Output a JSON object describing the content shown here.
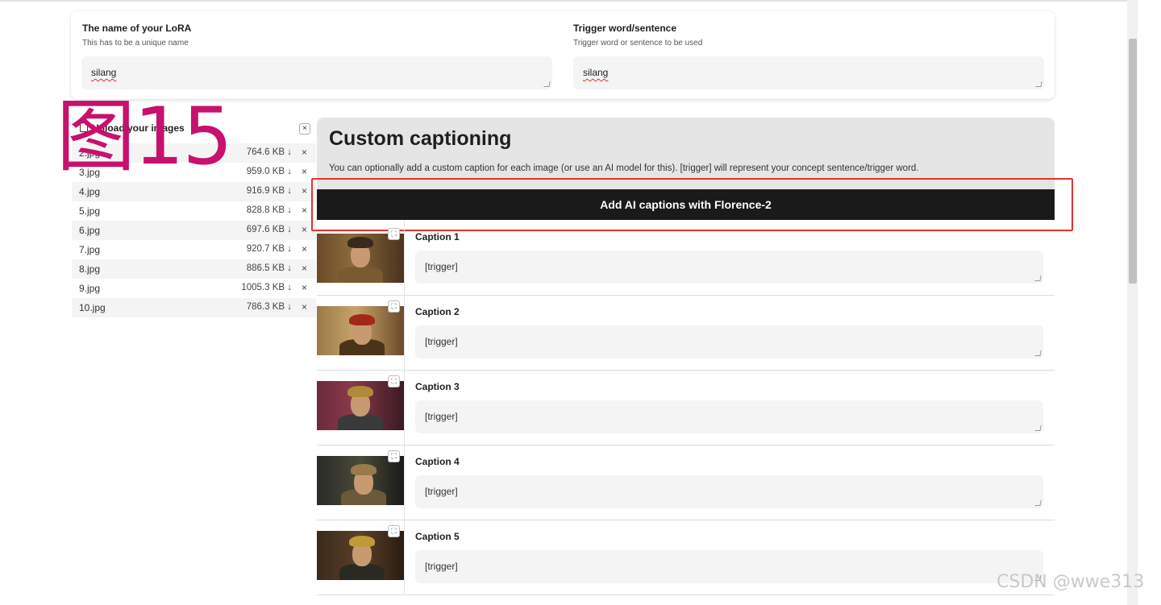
{
  "figure_label": "图15",
  "watermark": "CSDN @wwe313",
  "lora_config": {
    "name_field": {
      "title": "The name of your LoRA",
      "subtitle": "This has to be a unique name",
      "value": "silang"
    },
    "trigger_field": {
      "title": "Trigger word/sentence",
      "subtitle": "Trigger word or sentence to be used",
      "value": "silang"
    }
  },
  "upload": {
    "title": "Upload your images",
    "close_label": "×",
    "files": [
      {
        "name": "2.jpg",
        "size": "764.6 KB ↓",
        "remove": "×"
      },
      {
        "name": "3.jpg",
        "size": "959.0 KB ↓",
        "remove": "×"
      },
      {
        "name": "4.jpg",
        "size": "916.9 KB ↓",
        "remove": "×"
      },
      {
        "name": "5.jpg",
        "size": "828.8 KB ↓",
        "remove": "×"
      },
      {
        "name": "6.jpg",
        "size": "697.6 KB ↓",
        "remove": "×"
      },
      {
        "name": "7.jpg",
        "size": "920.7 KB ↓",
        "remove": "×"
      },
      {
        "name": "8.jpg",
        "size": "886.5 KB ↓",
        "remove": "×"
      },
      {
        "name": "9.jpg",
        "size": "1005.3 KB ↓",
        "remove": "×"
      },
      {
        "name": "10.jpg",
        "size": "786.3 KB ↓",
        "remove": "×"
      }
    ]
  },
  "captioning": {
    "heading": "Custom captioning",
    "description": "You can optionally add a custom caption for each image (or use an AI model for this). [trigger] will represent your concept sentence/trigger word.",
    "ai_button_label": "Add AI captions with Florence-2",
    "expand_icon": "⛶",
    "rows": [
      {
        "label": "Caption 1",
        "value": "[trigger]"
      },
      {
        "label": "Caption 2",
        "value": "[trigger]"
      },
      {
        "label": "Caption 3",
        "value": "[trigger]"
      },
      {
        "label": "Caption 4",
        "value": "[trigger]"
      },
      {
        "label": "Caption 5",
        "value": "[trigger]"
      }
    ]
  },
  "colors": {
    "accent_button": "#1a1a1a",
    "highlight_box": "#e5322d",
    "figure_label": "#c8106e"
  }
}
